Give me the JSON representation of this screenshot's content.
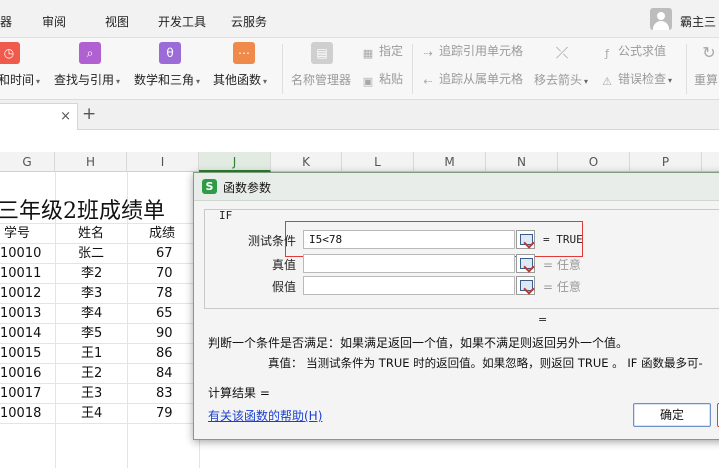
{
  "menu": {
    "items": [
      "审阅",
      "视图",
      "开发工具",
      "云服务"
    ],
    "partial_left": "器",
    "username": "霸主三"
  },
  "ribbon": {
    "groups": [
      {
        "label": "和时间",
        "icon": "clock-icon",
        "color": "#ef5a4c"
      },
      {
        "label": "查找与引用",
        "icon": "search-icon",
        "color": "#b060d0"
      },
      {
        "label": "数学和三角",
        "icon": "theta-icon",
        "color": "#9b6cd8"
      },
      {
        "label": "其他函数",
        "icon": "more-icon",
        "color": "#f08a4b"
      }
    ],
    "name_manager": "名称管理器",
    "define": "指定",
    "paste": "粘贴",
    "trace_precedents": "追踪引用单元格",
    "trace_dependents": "追踪从属单元格",
    "remove_arrows": "移去箭头",
    "evaluate_formula": "公式求值",
    "error_check": "错误检查",
    "recalc": "重算"
  },
  "tab": {
    "close": "×",
    "new": "+"
  },
  "sheet": {
    "columns": [
      "G",
      "H",
      "I",
      "J",
      "K",
      "L",
      "M",
      "N",
      "O",
      "P"
    ],
    "selected_column": "J",
    "title": "三年级2班成绩单",
    "headers": [
      "学号",
      "姓名",
      "成绩"
    ],
    "rows": [
      {
        "id": "10010",
        "name": "张二",
        "score": "67"
      },
      {
        "id": "10011",
        "name": "李2",
        "score": "70"
      },
      {
        "id": "10012",
        "name": "李3",
        "score": "78"
      },
      {
        "id": "10013",
        "name": "李4",
        "score": "65"
      },
      {
        "id": "10014",
        "name": "李5",
        "score": "90"
      },
      {
        "id": "10015",
        "name": "王1",
        "score": "86"
      },
      {
        "id": "10016",
        "name": "王2",
        "score": "84"
      },
      {
        "id": "10017",
        "name": "王3",
        "score": "83"
      },
      {
        "id": "10018",
        "name": "王4",
        "score": "79"
      }
    ]
  },
  "dialog": {
    "icon_letter": "S",
    "title": "函数参数",
    "function_name": "IF",
    "args": [
      {
        "label": "测试条件",
        "value": "I5<78",
        "result": "= TRUE"
      },
      {
        "label": "真值",
        "value": "",
        "result": "= 任意"
      },
      {
        "label": "假值",
        "value": "",
        "result": "= 任意"
      }
    ],
    "function_result": "=",
    "description": "判断一个条件是否满足：如果满足返回一个值，如果不满足则返回另外一个值。",
    "arg_description": "真值：  当测试条件为 TRUE 时的返回值。如果忽略，则返回 TRUE 。 IF 函数最多可-",
    "calc_result": "计算结果 =",
    "help_link": "有关该函数的帮助(H)",
    "ok": "确定"
  }
}
